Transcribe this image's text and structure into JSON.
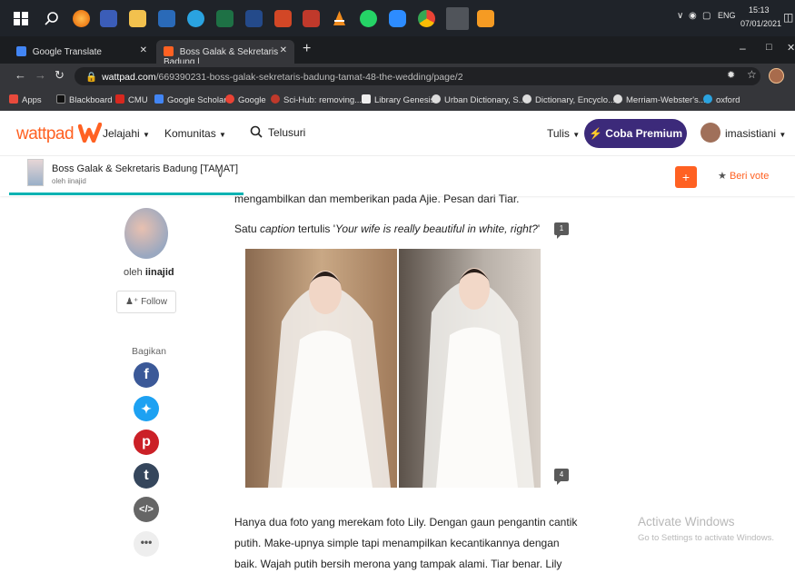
{
  "taskbar": {
    "tray_lang": "ENG",
    "tray_time": "15:13",
    "tray_date": "07/01/2021"
  },
  "browser": {
    "tabs": [
      {
        "label": "Google Translate",
        "active": false
      },
      {
        "label": "Boss Galak & Sekretaris Badung | ",
        "active": true
      }
    ],
    "url_host": "wattpad.com",
    "url_path": "/669390231-boss-galak-sekretaris-badung-tamat-48-the-wedding/page/2",
    "bookmarks": [
      {
        "label": "Apps",
        "icon": "apps-grid-icon",
        "color": "#e84a3c"
      },
      {
        "label": "Blackboard",
        "icon": "blackboard-icon",
        "color": "#222"
      },
      {
        "label": "CMU",
        "icon": "cmu-icon",
        "color": "#d7281f"
      },
      {
        "label": "Google Scholar",
        "icon": "scholar-icon",
        "color": "#4285f4"
      },
      {
        "label": "Google",
        "icon": "google-icon",
        "color": "#ea4335"
      },
      {
        "label": "Sci-Hub: removing...",
        "icon": "scihub-icon",
        "color": "#c0392b"
      },
      {
        "label": "Library Genesis",
        "icon": "libgen-icon",
        "color": "#eee"
      },
      {
        "label": "Urban Dictionary, S...",
        "icon": "globe-icon",
        "color": "#ddd"
      },
      {
        "label": "Dictionary, Encyclo...",
        "icon": "globe-icon",
        "color": "#ddd"
      },
      {
        "label": "Merriam-Webster's...",
        "icon": "globe-icon",
        "color": "#ddd"
      },
      {
        "label": "oxford",
        "icon": "oxford-icon",
        "color": "#2aa3e0"
      }
    ]
  },
  "header": {
    "logo_text": "wattpad",
    "nav_explore": "Jelajahi",
    "nav_community": "Komunitas",
    "search_label": "Telusuri",
    "write_label": "Tulis",
    "premium_label": "Coba Premium",
    "username": "imasistiani"
  },
  "story": {
    "title": "Boss Galak & Sekretaris Badung [TAMAT]",
    "author_line": "oleh iinajid",
    "vote_label": "Beri vote",
    "add_label": "+"
  },
  "sidebar": {
    "by_prefix": "oleh ",
    "author": "iinajid",
    "follow_label": "Follow",
    "share_label": "Bagikan",
    "share_icons": [
      "facebook-icon",
      "twitter-icon",
      "pinterest-icon",
      "tumblr-icon",
      "embed-icon",
      "more-icon"
    ]
  },
  "content": {
    "para_top_cut": "mengambilkan dan memberikan pada Ajie. Pesan dari Tiar.",
    "caption_prefix": "Satu ",
    "caption_word": "caption",
    "caption_mid": " tertulis '",
    "caption_quote": "Your wife is really beautiful in white, right?",
    "caption_end": "'",
    "comment_count_1": "1",
    "comment_count_2": "4",
    "para_lines": [
      "Hanya dua foto yang merekam foto Lily. Dengan gaun pengantin cantik",
      "putih. Make-upnya simple tapi menampilkan kecantikannya dengan",
      "baik. Wajah putih bersih merona yang tampak alami. Tiar benar. Lily"
    ]
  },
  "watermark": {
    "title": "Activate Windows",
    "subtitle": "Go to Settings to activate Windows."
  },
  "colors": {
    "wattpad_orange": "#ff6122",
    "premium_purple": "#3c2a7a",
    "teal_progress": "#00b2b2"
  }
}
